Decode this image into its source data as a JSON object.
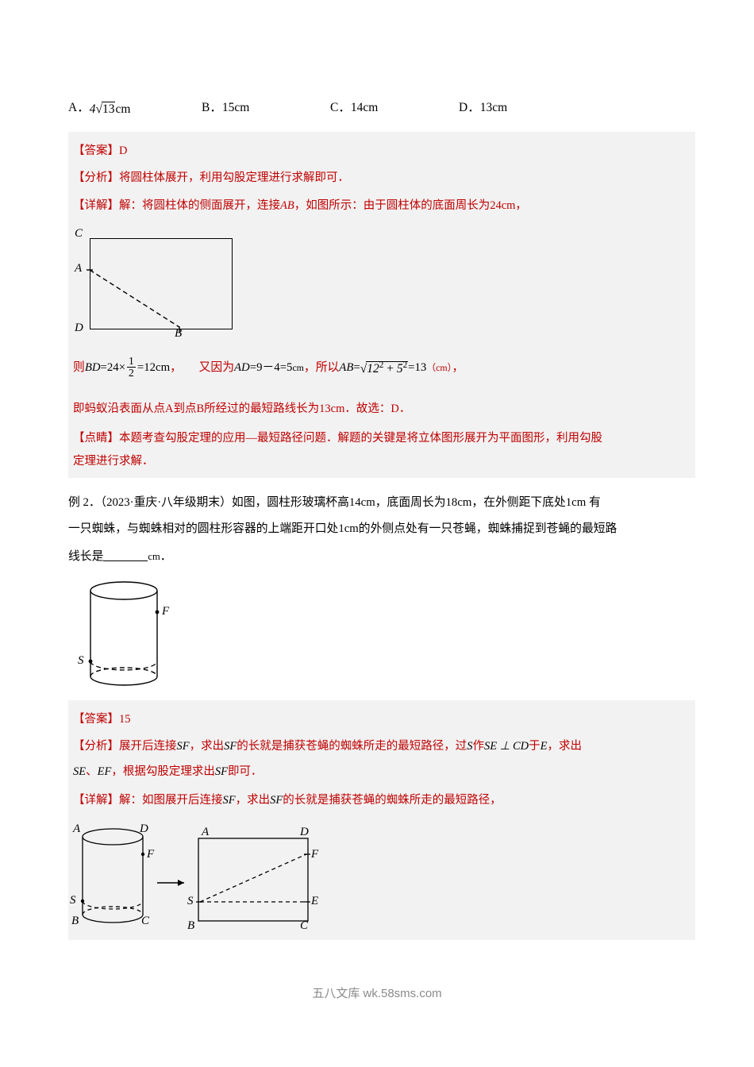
{
  "choices": [
    {
      "label": "A．",
      "value": "4√13cm",
      "coef": "4",
      "radicand": "13",
      "unit": "cm"
    },
    {
      "label": "B．",
      "value": "15cm"
    },
    {
      "label": "C．",
      "value": "14cm"
    },
    {
      "label": "D．",
      "value": "13cm"
    }
  ],
  "answer_block_1": {
    "answer_tag": "【答案】",
    "answer_value": "D",
    "analysis_tag": "【分析】",
    "analysis_text": "将圆柱体展开，利用勾股定理进行求解即可．",
    "detail_tag": "【详解】",
    "detail_text_1": "解：将圆柱体的侧面展开，连接",
    "detail_ab": "AB",
    "detail_text_2": "，如图所示：由于圆柱体的底面周长为24cm，",
    "then_label": "则",
    "bd_expr_pre": "BD",
    "bd_expr_eq": "=24×",
    "bd_frac_num": "1",
    "bd_frac_den": "2",
    "bd_expr_post": "=12cm",
    "comma1": "，",
    "because_text": "又因为",
    "ad_expr": "AD",
    "ad_eq": "=9－4=5",
    "ad_unit": "cm",
    "so_text": "，所以",
    "ab_expr": "AB",
    "ab_eq": "=",
    "ab_sqrt": "12² + 5²",
    "ab_result": "=13",
    "ab_unit": "（cm）",
    "comma2": "，",
    "conclusion": "即蚂蚁沿表面从点A到点B所经过的最短路线长为13cm．故选：D．",
    "highlight_tag": "【点睛】",
    "highlight_text_1": "本题考查勾股定理的应用—最短路径问题．解题的关键是将立体图形展开为平面图形，利用勾股",
    "highlight_text_2": "定理进行求解．"
  },
  "figure_1": {
    "labels": {
      "C": "C",
      "A": "A",
      "D": "D",
      "B": "B"
    }
  },
  "question_2": {
    "line1": "例 2．（2023·重庆·八年级期末）如图，圆柱形玻璃杯高14cm，底面周长为18cm，在外侧距下底处1cm 有",
    "line2": "一只蜘蛛，与蜘蛛相对的圆柱形容器的上端距开口处1cm的外侧点处有一只苍蝇，蜘蛛捕捉到苍蝇的最短路",
    "line3_pre": "线长是",
    "line3_unit": "cm",
    "line3_post": "．",
    "h": "14cm",
    "c": "18cm",
    "d1": "1cm",
    "d2": "1cm"
  },
  "figure_2": {
    "labels": {
      "F": "F",
      "S": "S"
    }
  },
  "answer_block_2": {
    "answer_tag": "【答案】",
    "answer_value": "15",
    "analysis_tag": "【分析】",
    "analysis_1": "展开后连接",
    "analysis_sf": "SF",
    "analysis_2": "，求出",
    "analysis_sf2": "SF",
    "analysis_3": "的长就是捕获苍蝇的蜘蛛所走的最短路径，过",
    "analysis_s": "S",
    "analysis_4": "作",
    "analysis_se_cd": "SE ⊥ CD",
    "analysis_5": "于",
    "analysis_e": "E",
    "analysis_6": "，求出",
    "analysis_line2_se": "SE",
    "analysis_line2_a": "、",
    "analysis_line2_ef": "EF",
    "analysis_line2_b": "，根据勾股定理求出",
    "analysis_line2_sf": "SF",
    "analysis_line2_c": "即可．",
    "detail_tag": "【详解】",
    "detail_1": "解：如图展开后连接",
    "detail_sf": "SF",
    "detail_2": "，求出",
    "detail_sf2": "SF",
    "detail_3": "的长就是捕获苍蝇的蜘蛛所走的最短路径，"
  },
  "figure_3": {
    "labels": {
      "A": "A",
      "D": "D",
      "F": "F",
      "S": "S",
      "B": "B",
      "C": "C",
      "A2": "A",
      "D2": "D",
      "F2": "F",
      "S2": "S",
      "E2": "E",
      "B2": "B",
      "C2": "C"
    }
  },
  "footer": {
    "text": "五八文库 wk.58sms.com"
  }
}
